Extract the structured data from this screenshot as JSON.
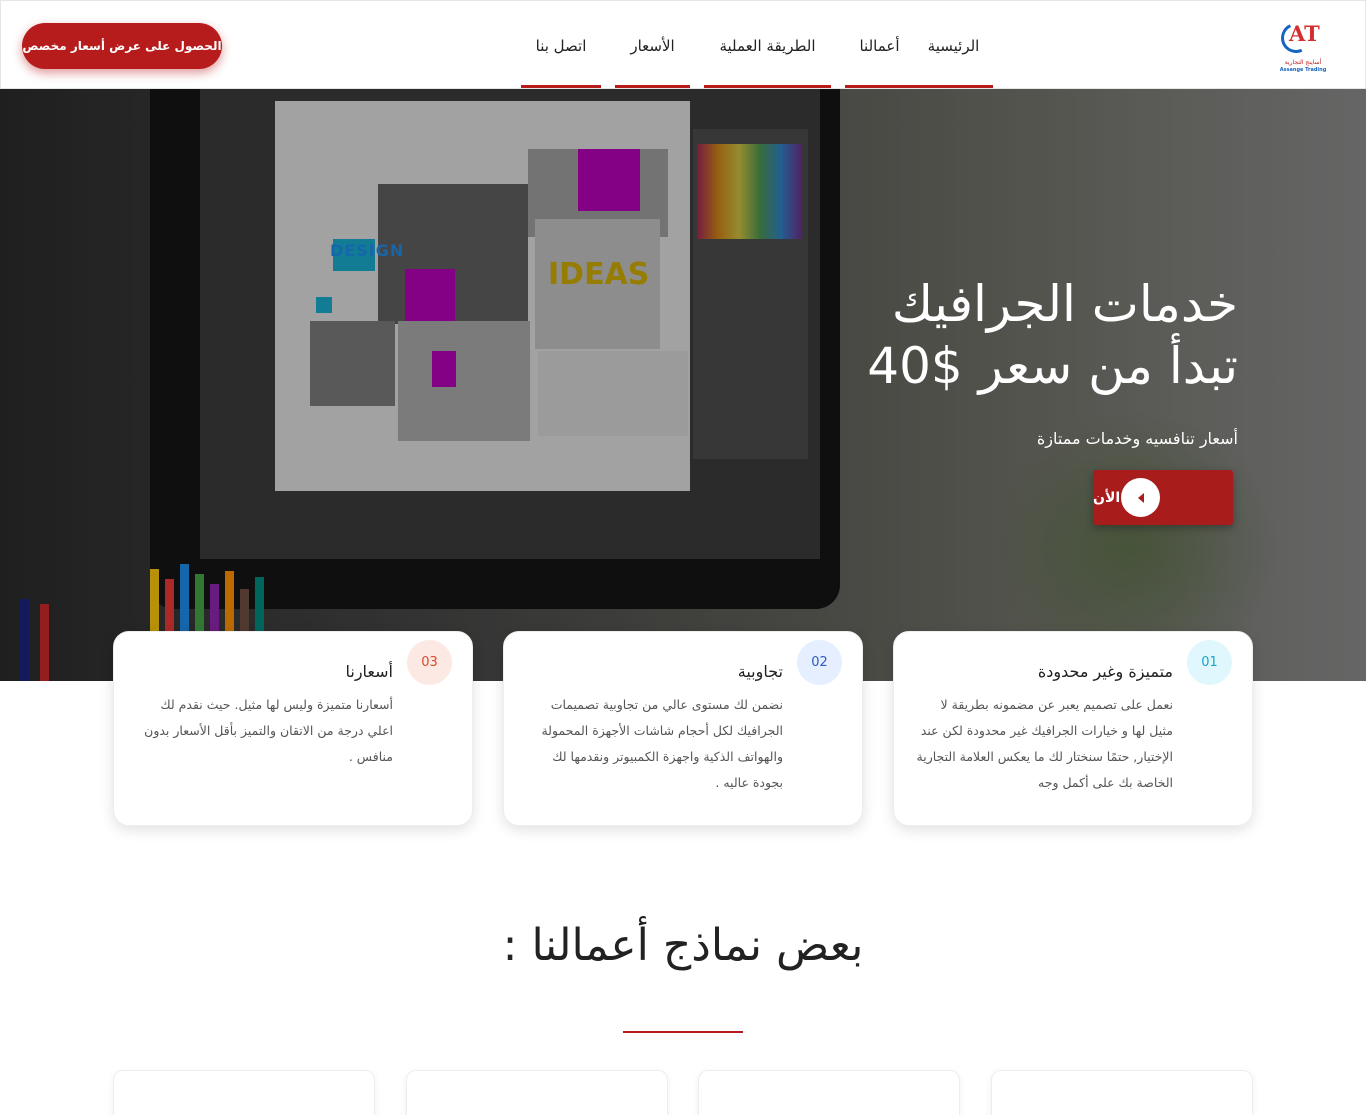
{
  "header": {
    "cta_label": "الحصول على عرض أسعار مخصص",
    "nav": [
      {
        "label": "الرئيسية"
      },
      {
        "label": "أعمالنا"
      },
      {
        "label": "الطريقة العملية"
      },
      {
        "label": "الأسعار"
      },
      {
        "label": "اتصل بنا"
      }
    ],
    "logo": {
      "mark": "AT",
      "sub_ar": "أساينج التجارية",
      "sub_en": "Assange Trading"
    }
  },
  "hero": {
    "title_line1": "خدمات الجرافيك",
    "title_line2": "تبدأ من سعر $40",
    "subtitle": "أسعار تنافسيه وخدمات ممتازة",
    "button_label": "أبدأ الأن",
    "image_text_design": "DESIGN",
    "image_text_ideas": "IDEAS"
  },
  "features": [
    {
      "number": "01",
      "title": "متميزة وغير محدودة",
      "text": "نعمل على تصميم يعبر عن مضمونه بطريقة لا مثيل لها و خيارات الجرافيك غير محدودة لكن عند الإختيار, حتمًا سنختار لك ما يعكس العلامة التجارية الخاصة بك على أكمل وجه",
      "badge_bg": "#e0f7fd",
      "badge_color": "#1aa5c9"
    },
    {
      "number": "02",
      "title": "تجاوبية",
      "text": "نضمن لك مستوى عالي من تجاوبية تصميمات الجرافيك لكل أحجام شاشات الأجهزة المحمولة والهواتف الذكية واجهزة الكمبيوتر ونقدمها لك بجودة عاليه .",
      "badge_bg": "#e6efff",
      "badge_color": "#2c5bc4"
    },
    {
      "number": "03",
      "title": "أسعارنا",
      "text": "أسعارنا متميزة وليس لها مثيل. حيث نقدم لك اعلي درجة من الاتقان والتميز بأقل الأسعار بدون منافس .",
      "badge_bg": "#fde9e4",
      "badge_color": "#d84a2b"
    }
  ],
  "section": {
    "title": "بعض نماذج أعمالنا :"
  },
  "colors": {
    "accent": "#b71c1c",
    "brand_blue": "#1565c0"
  }
}
